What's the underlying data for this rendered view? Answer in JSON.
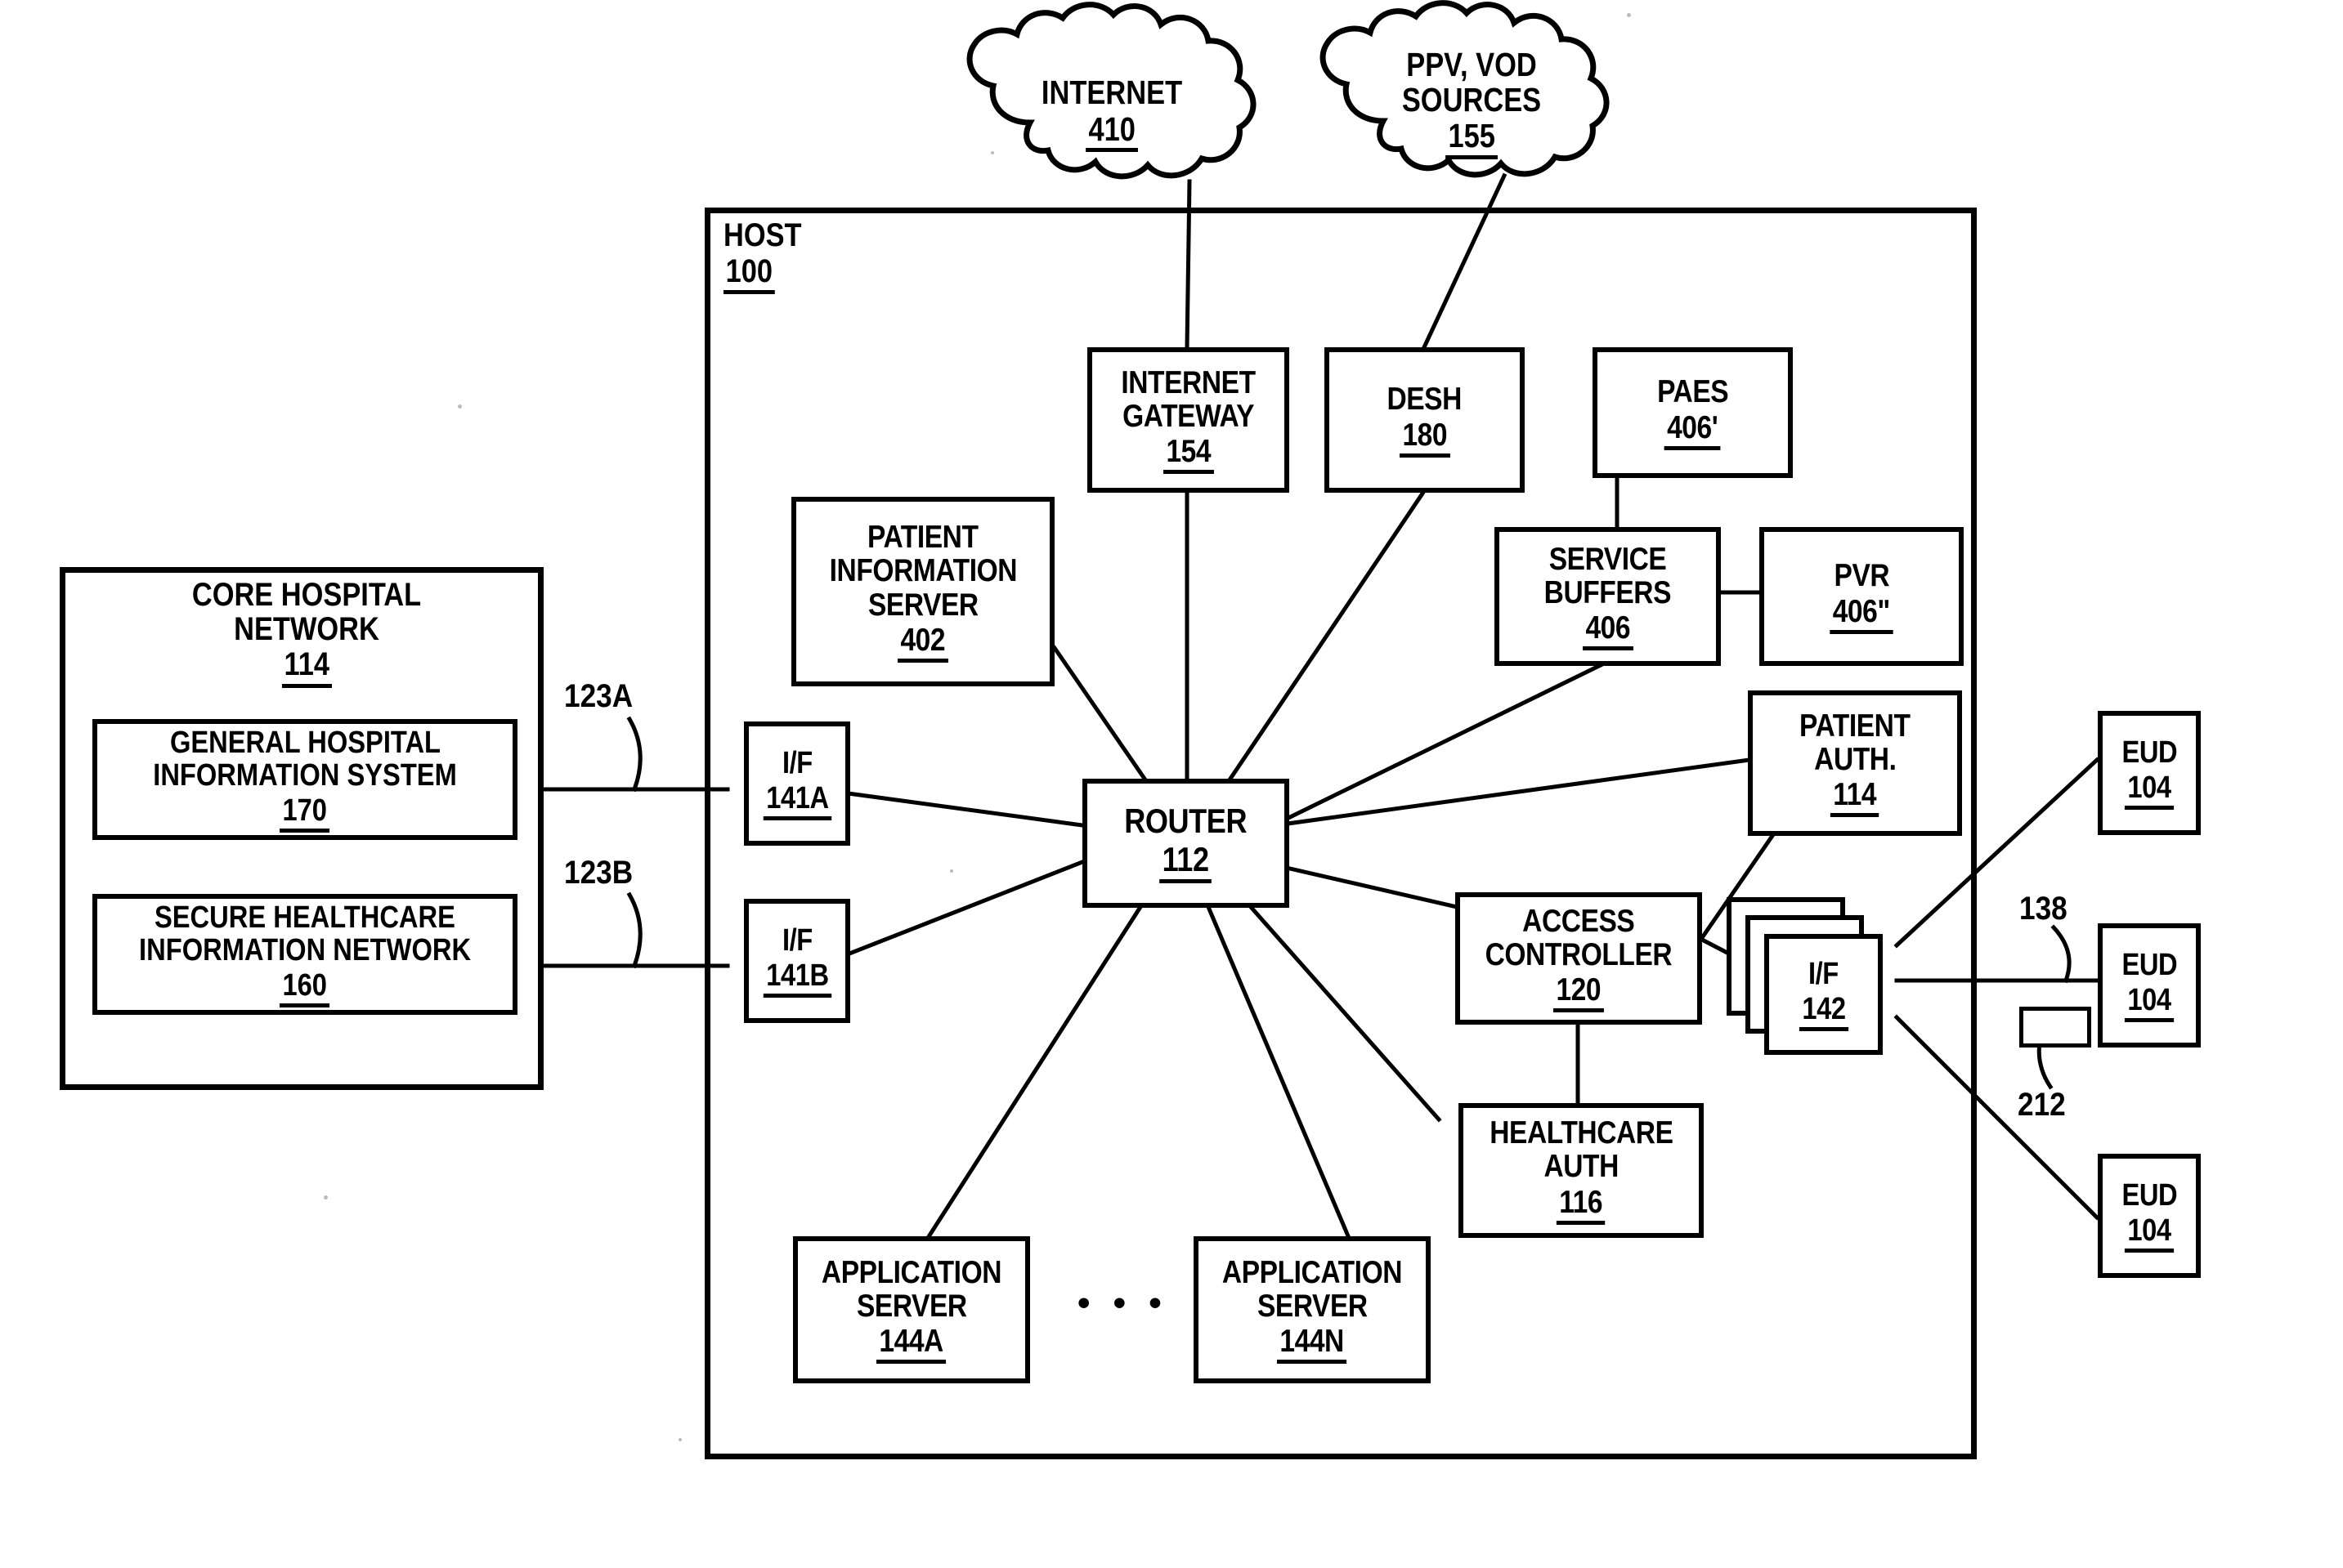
{
  "figure": {
    "title": "Healthcare Host Network Architecture Patent Diagram"
  },
  "clouds": [
    {
      "id": "internet",
      "label": "INTERNET",
      "number": "410"
    },
    {
      "id": "ppv_vod",
      "label_line1": "PPV, VOD",
      "label_line2": "SOURCES",
      "number": "155"
    }
  ],
  "host": {
    "label": "HOST",
    "number": "100"
  },
  "core_network": {
    "label": "CORE HOSPITAL NETWORK",
    "number": "114",
    "children": [
      {
        "id": "ghis",
        "line1": "GENERAL HOSPITAL",
        "line2": "INFORMATION SYSTEM",
        "number": "170"
      },
      {
        "id": "shin",
        "line1": "SECURE HEALTHCARE",
        "line2": "INFORMATION NETWORK",
        "number": "160"
      }
    ]
  },
  "nodes": {
    "internet_gateway": {
      "line1": "INTERNET",
      "line2": "GATEWAY",
      "number": "154"
    },
    "desh": {
      "line1": "DESH",
      "number": "180"
    },
    "paes": {
      "line1": "PAES",
      "number": "406'"
    },
    "service_buffers": {
      "line1": "SERVICE",
      "line2": "BUFFERS",
      "number": "406"
    },
    "pvr": {
      "line1": "PVR",
      "number": "406\""
    },
    "patient_information_server": {
      "line1": "PATIENT",
      "line2": "INFORMATION",
      "line3": "SERVER",
      "number": "402"
    },
    "patient_auth": {
      "line1": "PATIENT",
      "line2": "AUTH.",
      "number": "114"
    },
    "router": {
      "line1": "ROUTER",
      "number": "112"
    },
    "access_controller": {
      "line1": "ACCESS",
      "line2": "CONTROLLER",
      "number": "120"
    },
    "healthcare_auth": {
      "line1": "HEALTHCARE",
      "line2": "AUTH",
      "number": "116"
    },
    "if_141a": {
      "line1": "I/F",
      "number": "141A"
    },
    "if_141b": {
      "line1": "I/F",
      "number": "141B"
    },
    "if_142": {
      "line1": "I/F",
      "number": "142"
    },
    "app_server_a": {
      "line1": "APPLICATION",
      "line2": "SERVER",
      "number": "144A"
    },
    "app_server_n": {
      "line1": "APPLICATION",
      "line2": "SERVER",
      "number": "144N"
    },
    "eud_1": {
      "line1": "EUD",
      "number": "104"
    },
    "eud_2": {
      "line1": "EUD",
      "number": "104"
    },
    "eud_3": {
      "line1": "EUD",
      "number": "104"
    }
  },
  "reference_labels": {
    "link_123a": "123A",
    "link_123b": "123B",
    "link_138": "138",
    "link_212": "212",
    "servers_ellipsis": "• • •"
  },
  "colors": {
    "line": "#000000",
    "background": "#ffffff"
  }
}
